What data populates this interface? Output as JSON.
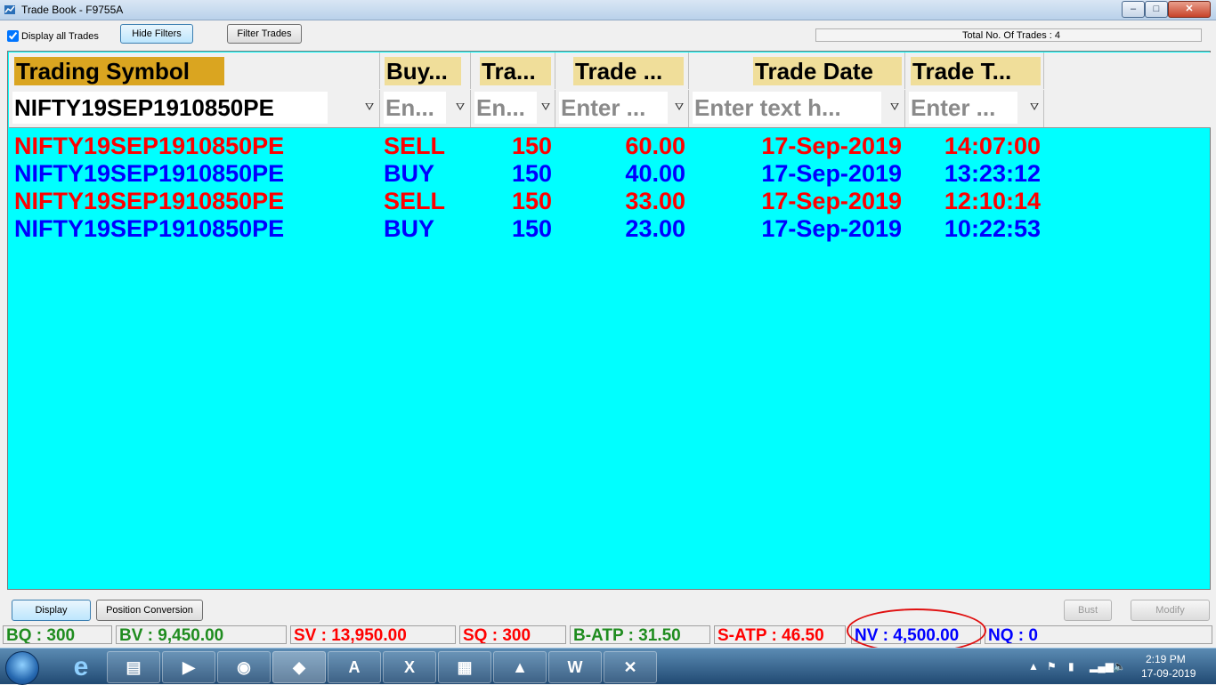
{
  "window": {
    "title": "Trade Book - F9755A",
    "minimize": "–",
    "maximize": "□",
    "close": "✕"
  },
  "toolbar": {
    "display_all_label": "Display all Trades",
    "display_all_checked": true,
    "hide_filters": "Hide Filters",
    "filter_trades": "Filter Trades",
    "total_trades": "Total No. Of Trades : 4"
  },
  "table": {
    "headers": [
      "Trading Symbol",
      "Buy...",
      "Tra...",
      "Trade ...",
      "Trade Date",
      "Trade T..."
    ],
    "filters": [
      "NIFTY19SEP1910850PE",
      "En...",
      "En...",
      "Enter ...",
      "Enter text h...",
      "Enter ..."
    ],
    "rows": [
      {
        "symbol": "NIFTY19SEP1910850PE",
        "side": "SELL",
        "qty": "150",
        "price": "60.00",
        "date": "17-Sep-2019",
        "time": "14:07:00",
        "color": "#ff0000"
      },
      {
        "symbol": "NIFTY19SEP1910850PE",
        "side": "BUY",
        "qty": "150",
        "price": "40.00",
        "date": "17-Sep-2019",
        "time": "13:23:12",
        "color": "#0000ff"
      },
      {
        "symbol": "NIFTY19SEP1910850PE",
        "side": "SELL",
        "qty": "150",
        "price": "33.00",
        "date": "17-Sep-2019",
        "time": "12:10:14",
        "color": "#ff0000"
      },
      {
        "symbol": "NIFTY19SEP1910850PE",
        "side": "BUY",
        "qty": "150",
        "price": "23.00",
        "date": "17-Sep-2019",
        "time": "10:22:53",
        "color": "#0000ff"
      }
    ],
    "grid_background": "#00ffff"
  },
  "buttons": {
    "display": "Display",
    "position_conversion": "Position Conversion",
    "bust": "Bust",
    "modify": "Modify"
  },
  "stats": {
    "bq": "BQ : 300",
    "bv": "BV : 9,450.00",
    "sv": "SV : 13,950.00",
    "sq": "SQ : 300",
    "batp": "B-ATP : 31.50",
    "satp": "S-ATP : 46.50",
    "nv": "NV : 4,500.00",
    "nq": "NQ : 0"
  },
  "taskbar": {
    "apps": [
      "ie-icon",
      "explorer-icon",
      "media-player-icon",
      "chrome-icon",
      "trading-app-icon",
      "acrobat-icon",
      "excel-icon",
      "calculator-icon",
      "paint-app-icon",
      "word-icon",
      "pdf-tool-icon"
    ],
    "time": "2:19 PM",
    "date": "17-09-2019"
  }
}
